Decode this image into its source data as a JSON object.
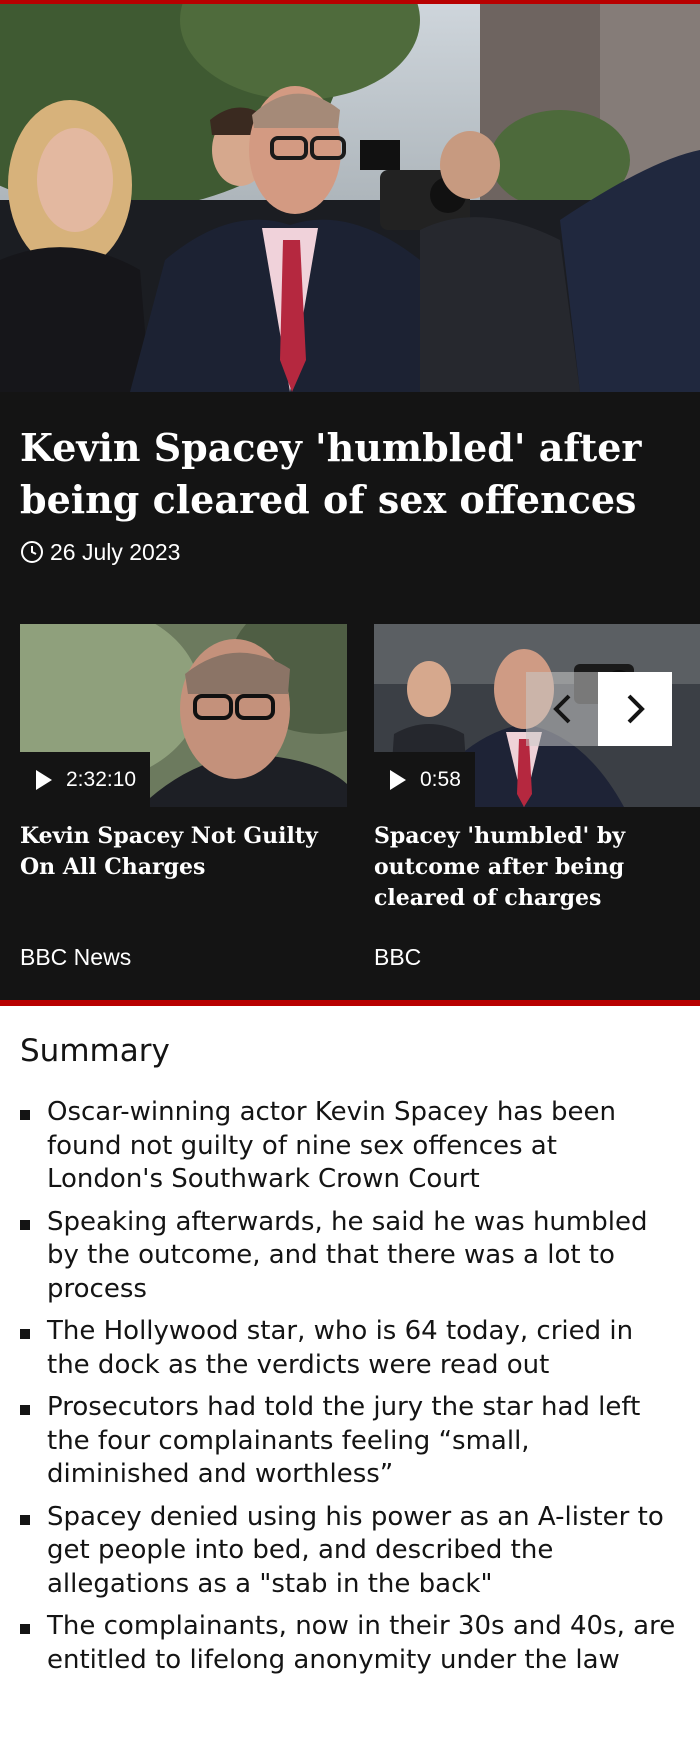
{
  "article": {
    "headline": "Kevin Spacey 'humbled' after being cleared of sex offences",
    "date": "26 July 2023"
  },
  "carousel": {
    "cards": [
      {
        "duration": "2:32:10",
        "title": "Kevin Spacey Not Guilty On All Charges",
        "source": "BBC News"
      },
      {
        "duration": "0:58",
        "title": "Spacey 'humbled' by outcome after being cleared of charges",
        "source": "BBC"
      }
    ],
    "prev_icon": "chevron-left-icon",
    "next_icon": "chevron-right-icon"
  },
  "summary": {
    "heading": "Summary",
    "items": [
      "Oscar-winning actor Kevin Spacey has been found not guilty of nine sex offences at London's Southwark Crown Court",
      "Speaking afterwards, he said he was humbled by the outcome, and that there was a lot to process",
      "The Hollywood star, who is 64 today, cried in the dock as the verdicts were read out",
      "Prosecutors had told the jury the star had left the four complainants feeling “small, diminished and worthless”",
      "Spacey denied using his power as an A-lister to get people into bed, and described the allegations as a \"stab in the back\"",
      "The complainants, now in their 30s and 40s, are entitled to lifelong anonymity under the law"
    ]
  },
  "colors": {
    "accent": "#b80000",
    "panel": "#141414"
  }
}
